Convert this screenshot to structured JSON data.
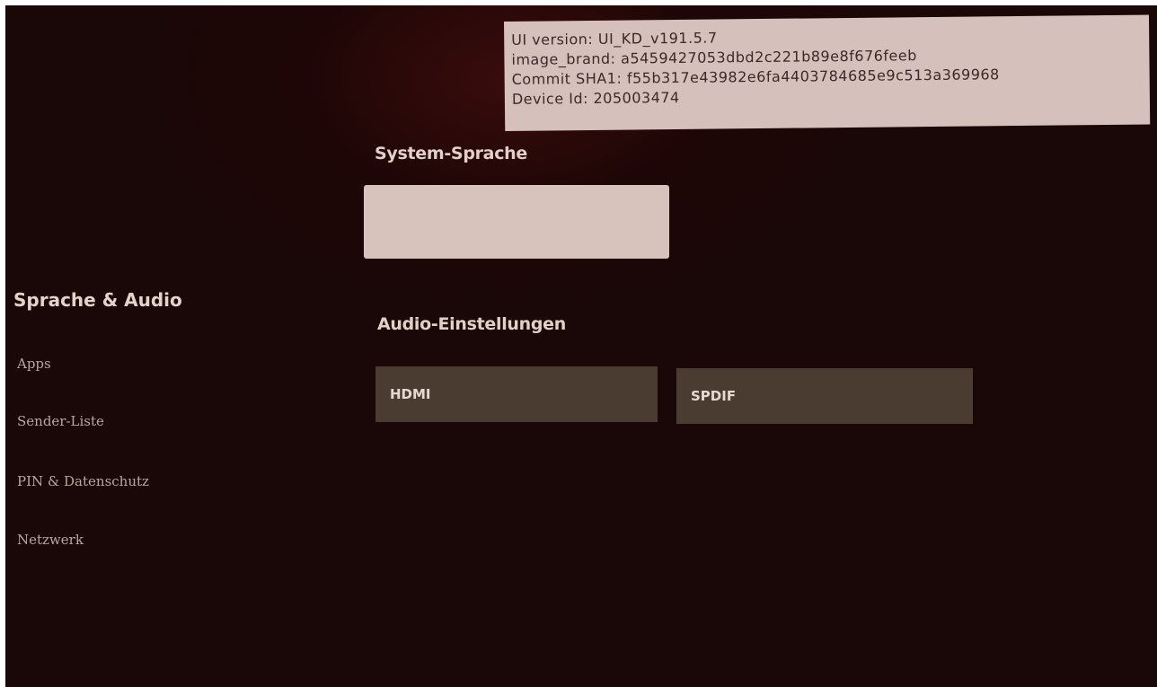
{
  "info": {
    "lines": [
      "UI version: UI_KD_v191.5.7",
      "image_brand: a5459427053dbd2c221b89e8f676feeb",
      "Commit SHA1: f55b317e43982e6fa4403784685e9c513a369968",
      "Device Id: 205003474"
    ]
  },
  "main": {
    "system_language_title": "System-Sprache",
    "system_language_value": "",
    "audio_settings_title": "Audio-Einstellungen",
    "audio_buttons": [
      "HDMI",
      "SPDIF"
    ]
  },
  "sidebar": {
    "items": [
      {
        "label": "Sprache & Audio",
        "active": true
      },
      {
        "label": "Apps",
        "active": false
      },
      {
        "label": "Sender-Liste",
        "active": false
      },
      {
        "label": "PIN & Datenschutz",
        "active": false
      },
      {
        "label": "Netzwerk",
        "active": false
      }
    ]
  },
  "colors": {
    "background": "#1a0707",
    "info_box": "#d6c0bb",
    "button": "#4a3c30",
    "text": "#e2cfc6"
  }
}
